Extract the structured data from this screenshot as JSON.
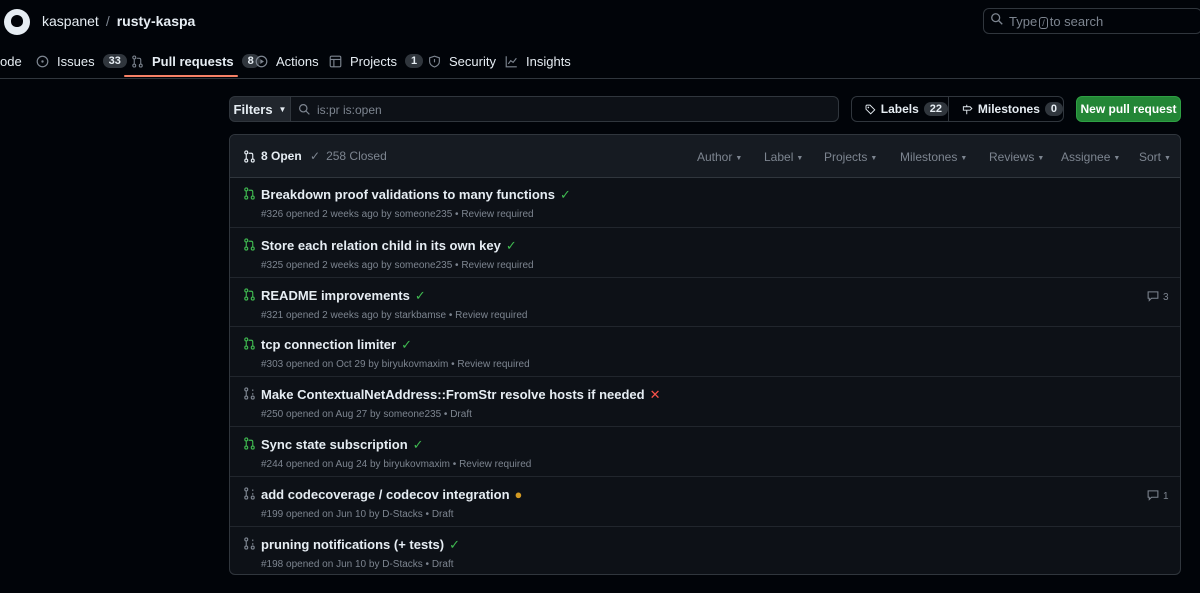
{
  "header": {
    "owner": "kaspanet",
    "separator": "/",
    "repo": "rusty-kaspa",
    "search_prefix": "Type",
    "search_key": "/",
    "search_suffix": "to search"
  },
  "nav": {
    "code": "ode",
    "issues": "Issues",
    "issues_count": "33",
    "pull_requests": "Pull requests",
    "pull_requests_count": "8",
    "actions": "Actions",
    "projects": "Projects",
    "projects_count": "1",
    "security": "Security",
    "insights": "Insights"
  },
  "toolbar": {
    "filters": "Filters",
    "query": "is:pr is:open",
    "labels": "Labels",
    "labels_count": "22",
    "milestones": "Milestones",
    "milestones_count": "0",
    "new_pr": "New pull request"
  },
  "list_header": {
    "open": "8 Open",
    "closed": "258 Closed",
    "author": "Author",
    "label": "Label",
    "projects": "Projects",
    "milestones": "Milestones",
    "reviews": "Reviews",
    "assignee": "Assignee",
    "sort": "Sort"
  },
  "colors": {
    "accent_green": "#3fb950",
    "fail_red": "#f85149",
    "pending_amber": "#d29922",
    "tab_underline": "#f78166",
    "button_green": "#238636"
  },
  "pulls": [
    {
      "title": "Breakdown proof validations to many functions",
      "status": "✓",
      "meta": "#326 opened 2 weeks ago by someone235 • Review required",
      "comments": ""
    },
    {
      "title": "Store each relation child in its own key",
      "status": "✓",
      "meta": "#325 opened 2 weeks ago by someone235 • Review required",
      "comments": ""
    },
    {
      "title": "README improvements",
      "status": "✓",
      "meta": "#321 opened 2 weeks ago by starkbamse • Review required",
      "comments": "3"
    },
    {
      "title": "tcp connection limiter",
      "status": "✓",
      "meta": "#303 opened on Oct 29 by biryukovmaxim • Review required",
      "comments": ""
    },
    {
      "title": "Make ContextualNetAddress::FromStr resolve hosts if needed",
      "status": "✕",
      "meta": "#250 opened on Aug 27 by someone235 • Draft",
      "comments": ""
    },
    {
      "title": "Sync state subscription",
      "status": "✓",
      "meta": "#244 opened on Aug 24 by biryukovmaxim • Review required",
      "comments": ""
    },
    {
      "title": "add codecoverage / codecov integration",
      "status": "●",
      "meta": "#199 opened on Jun 10 by D-Stacks • Draft",
      "comments": "1"
    },
    {
      "title": "pruning notifications (+ tests)",
      "status": "✓",
      "meta": "#198 opened on Jun 10 by D-Stacks • Draft",
      "comments": ""
    }
  ]
}
